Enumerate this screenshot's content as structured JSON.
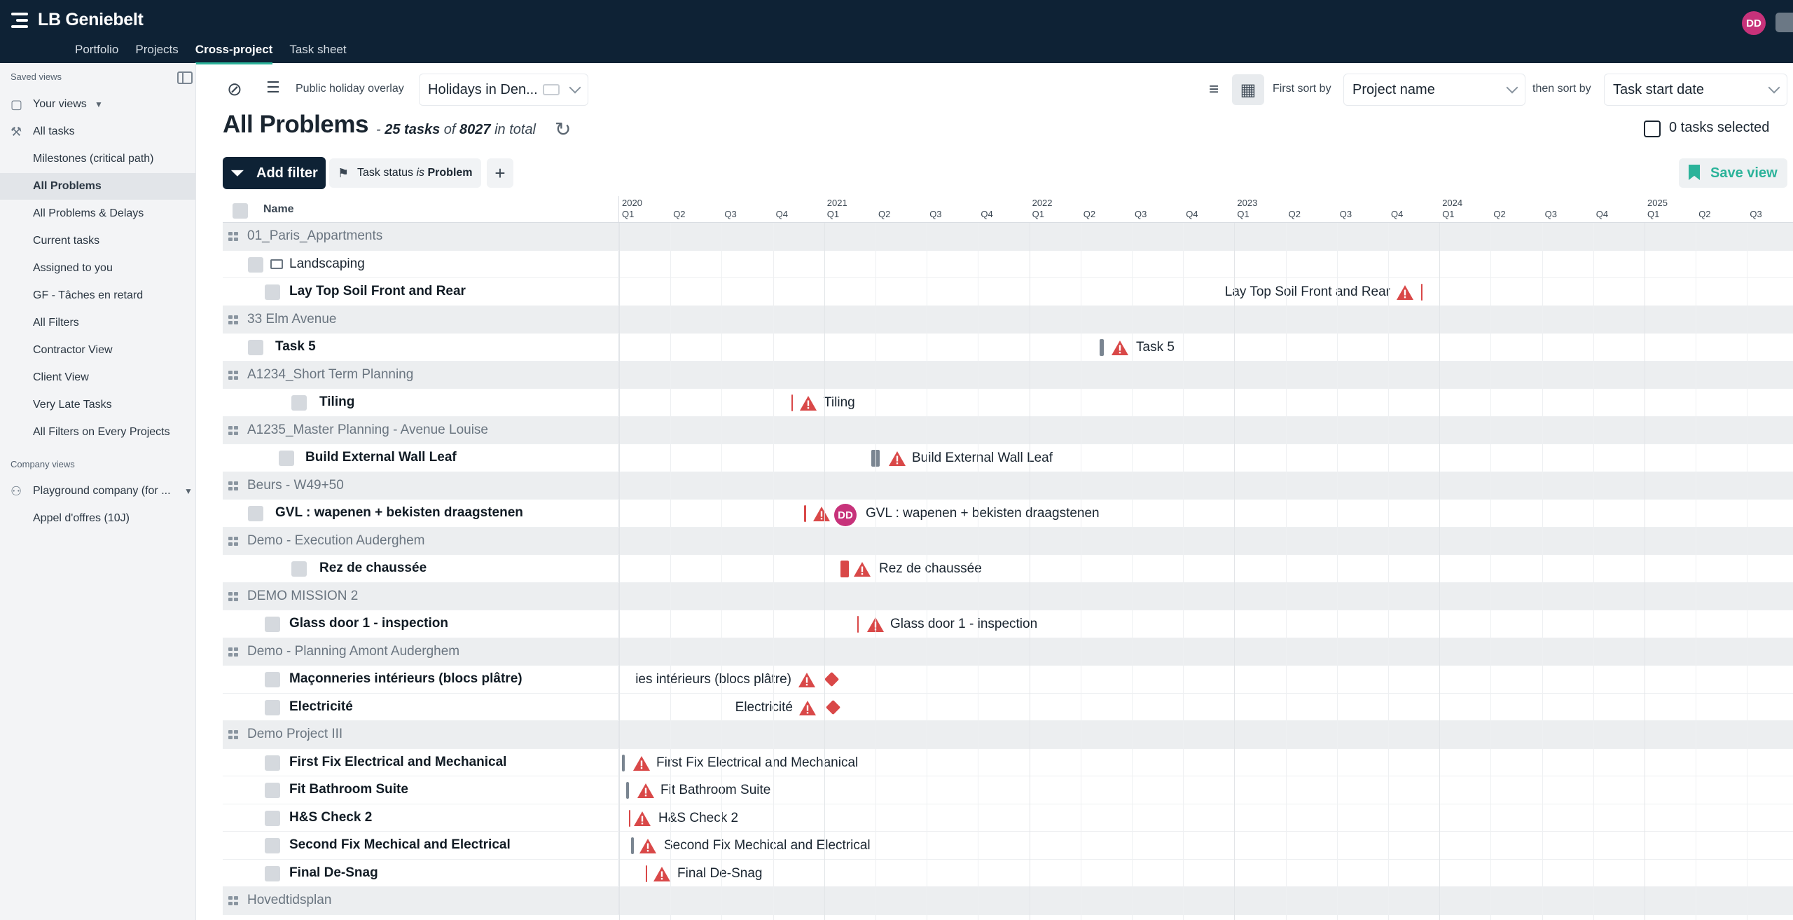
{
  "app": {
    "title": "LB Geniebelt",
    "user_initials": "DD"
  },
  "topnav": [
    "Portfolio",
    "Projects",
    "Cross-project",
    "Task sheet"
  ],
  "sidebar": {
    "saved_views_label": "Saved views",
    "your_views_label": "Your views",
    "items": [
      "All tasks",
      "Milestones (critical path)",
      "All Problems",
      "All Problems & Delays",
      "Current tasks",
      "Assigned to you",
      "GF - Tâches en retard",
      "All Filters",
      "Contractor View",
      "Client View",
      "Very Late Tasks",
      "All Filters on Every Projects"
    ],
    "company_views_label": "Company views",
    "company_items": [
      "Playground company (for ...",
      "Appel d'offres (10J)"
    ]
  },
  "toolbar": {
    "holiday_label": "Public holiday overlay",
    "holiday_value": "Holidays in Den...",
    "first_sort_label": "First sort by",
    "first_sort_value": "Project name",
    "then_sort_label": "then sort by",
    "then_sort_value": "Task start date"
  },
  "page": {
    "title": "All Problems",
    "dash": "-",
    "count": "25 tasks",
    "of": "of",
    "total": "8027",
    "in_total": "in total",
    "selected": "0 tasks selected"
  },
  "filters": {
    "add_label": "Add filter",
    "chip_prefix": "Task status",
    "chip_op": "is",
    "chip_value": "Problem",
    "save_view": "Save view"
  },
  "grid": {
    "name_header": "Name",
    "years": [
      "2020",
      "2021",
      "2022",
      "2023",
      "2024",
      "2025"
    ],
    "quarters": [
      "Q1",
      "Q2",
      "Q3",
      "Q4"
    ],
    "rows": [
      {
        "type": "group",
        "label": "01_Paris_Appartments"
      },
      {
        "type": "folder",
        "label": "Landscaping"
      },
      {
        "type": "task",
        "label": "Lay Top Soil Front and Rear",
        "tl_text": "Lay Top Soil Front and Rear"
      },
      {
        "type": "group",
        "label": "33 Elm Avenue"
      },
      {
        "type": "task",
        "label": "Task 5",
        "tl_text": "Task 5"
      },
      {
        "type": "group",
        "label": "A1234_Short Term Planning"
      },
      {
        "type": "task",
        "label": "Tiling",
        "tl_text": "Tiling"
      },
      {
        "type": "group",
        "label": "A1235_Master Planning - Avenue Louise"
      },
      {
        "type": "task",
        "label": "Build External Wall Leaf",
        "tl_text": "Build External Wall Leaf"
      },
      {
        "type": "group",
        "label": "Beurs - W49+50"
      },
      {
        "type": "task",
        "label": "GVL : wapenen + bekisten draagstenen",
        "tl_text": "GVL : wapenen + bekisten draagstenen",
        "assignee": "DD"
      },
      {
        "type": "group",
        "label": "Demo - Execution Auderghem"
      },
      {
        "type": "task",
        "label": "Rez de chaussée",
        "tl_text": "Rez de chaussée"
      },
      {
        "type": "group",
        "label": "DEMO MISSION 2"
      },
      {
        "type": "task",
        "label": "Glass door 1 - inspection",
        "tl_text": "Glass door 1 - inspection"
      },
      {
        "type": "group",
        "label": "Demo - Planning Amont Auderghem"
      },
      {
        "type": "task",
        "label": "Maçonneries intérieurs (blocs plâtre)",
        "tl_text": "ies intérieurs (blocs plâtre)"
      },
      {
        "type": "task",
        "label": "Electricité",
        "tl_text": "Electricité"
      },
      {
        "type": "group",
        "label": "Demo Project III"
      },
      {
        "type": "task",
        "label": "First Fix Electrical and Mechanical",
        "tl_text": "First Fix Electrical and Mechanical"
      },
      {
        "type": "task",
        "label": "Fit Bathroom Suite",
        "tl_text": "Fit Bathroom Suite"
      },
      {
        "type": "task",
        "label": "H&S Check 2",
        "tl_text": "H&S Check 2"
      },
      {
        "type": "task",
        "label": "Second Fix Mechical and Electrical",
        "tl_text": "Second Fix Mechical and Electrical"
      },
      {
        "type": "task",
        "label": "Final De-Snag",
        "tl_text": "Final De-Snag"
      },
      {
        "type": "group",
        "label": "Hovedtidsplan"
      }
    ]
  },
  "colors": {
    "nav_bg": "#0e2235",
    "accent": "#2bb39a",
    "problem": "#d94848",
    "avatar": "#c7327a"
  }
}
